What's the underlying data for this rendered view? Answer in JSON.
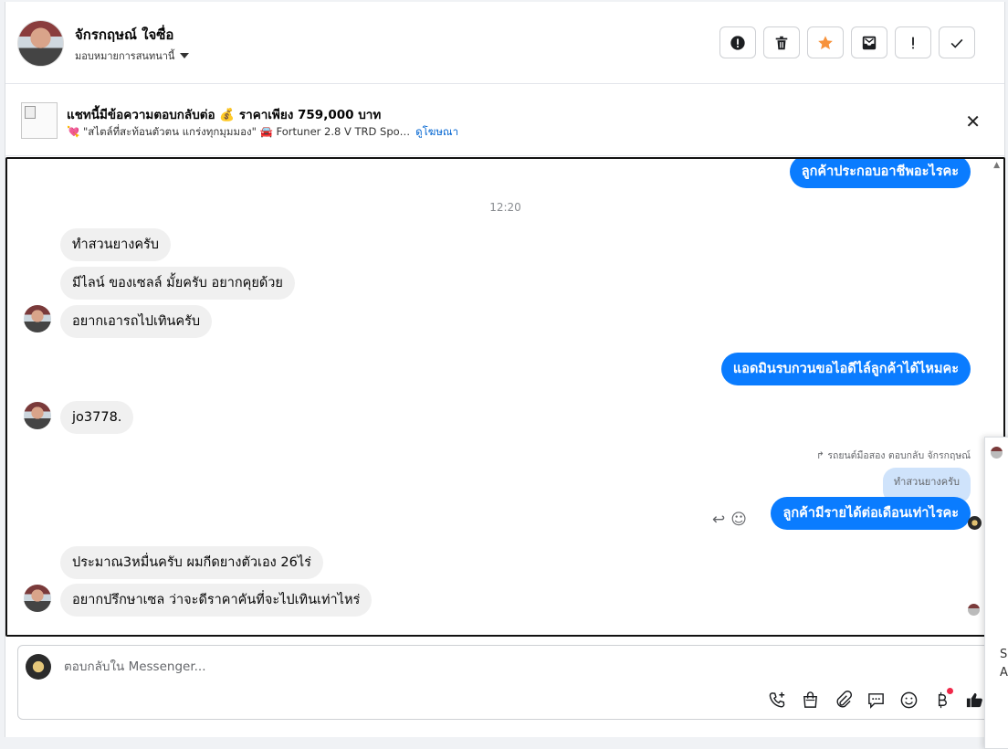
{
  "header": {
    "contact_name": "จักรกฤษณ์ ใจซื่อ",
    "assign_label": "มอบหมายการสนทนานี้",
    "toolbar": [
      "spam-alert-icon",
      "trash-icon",
      "star-icon",
      "mark-unread-icon",
      "follow-up-icon",
      "done-icon"
    ]
  },
  "ad": {
    "title": "แชทนี้มีข้อความตอบกลับต่อ 💰 ราคาเพียง 759,000 บาท",
    "subtitle": "💘 \"สไตล์ที่สะท้อนตัวตน แกร่งทุกมุมมอง\" 🚘 Fortuner 2.8 V TRD Spo…",
    "link": "ดูโฆษณา"
  },
  "chat": {
    "timestamp": "12:20",
    "messages": [
      {
        "text": "ลูกค้าประกอบอาชีพอะไรคะ"
      },
      {
        "text": "ทำสวนยางครับ"
      },
      {
        "text": "มีไลน์ ของเซลล์  มั้ยครับ   อยากคุยด้วย"
      },
      {
        "text": "อยากเอารถไปเทินครับ"
      },
      {
        "text": "แอดมินรบกวนขอไอดีไล์ลูกค้าได้ไหมคะ"
      },
      {
        "text": "jo3778."
      },
      {
        "text": "รถยนต์มือสอง ตอบกลับ จักรกฤษณ์"
      },
      {
        "text": "ทำสวนยางครับ"
      },
      {
        "text": "ลูกค้ามีรายได้ต่อเดือนเท่าไรคะ"
      },
      {
        "text": "ประมาณ3หมื่นครับ   ผมกีดยางตัวเอง  26ไร่"
      },
      {
        "text": "อยากปรึกษาเซล  ว่าจะดีราคาคันที่จะไปเทินเท่าไหร่"
      }
    ]
  },
  "composer": {
    "placeholder": "ตอบกลับใน Messenger..."
  },
  "side": {
    "line1": "So",
    "line2": "A"
  },
  "colors": {
    "outgoing": "#0a7cff",
    "incoming": "#f0f0f0",
    "link": "#0064d1"
  }
}
